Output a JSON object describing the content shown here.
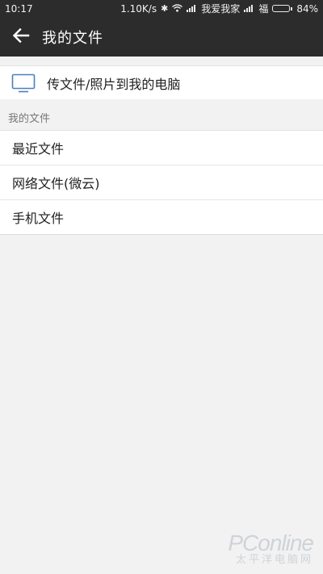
{
  "status_bar": {
    "time": "10:17",
    "speed": "1.10K/s",
    "carrier": "我爱我家",
    "sim2_label": "福",
    "battery_percent": "84%",
    "battery_level": 0.84
  },
  "toolbar": {
    "title": "我的文件",
    "back_icon": "arrow-left-icon"
  },
  "upload": {
    "label": "传文件/照片到我的电脑",
    "icon": "monitor-icon",
    "icon_color": "#4a7fc1"
  },
  "section": {
    "title": "我的文件"
  },
  "files": [
    {
      "label": "最近文件"
    },
    {
      "label": "网络文件(微云)"
    },
    {
      "label": "手机文件"
    }
  ],
  "watermark": {
    "logo": "PConline",
    "sub": "太平洋电脑网"
  },
  "colors": {
    "bar_bg": "#2c2c2c",
    "page_bg": "#f2f2f2",
    "row_bg": "#ffffff"
  }
}
